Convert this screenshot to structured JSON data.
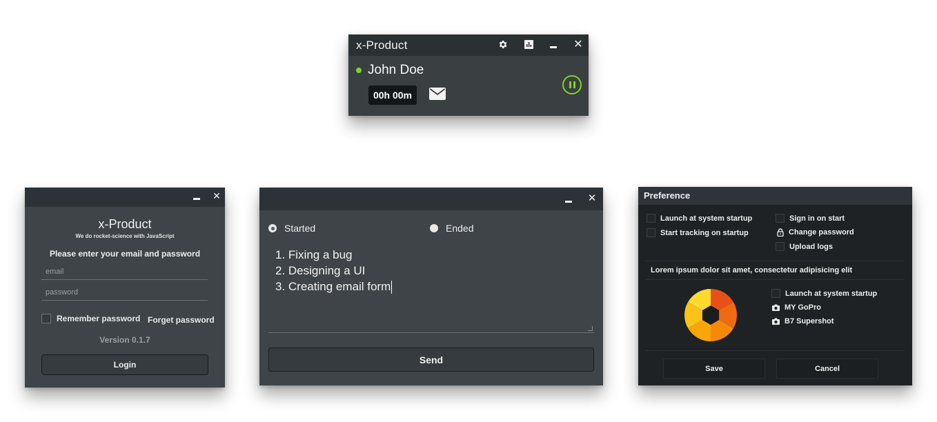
{
  "widget": {
    "title": "x-Product",
    "user_name": "John Doe",
    "timer": "00h 00m",
    "icons": [
      "gear-icon",
      "chart-icon",
      "minimize-icon",
      "close-icon",
      "mail-icon",
      "pause-icon"
    ],
    "status_color": "#7ed321"
  },
  "login": {
    "title": "x-Product",
    "tagline": "We do rocket-science with JavaScript",
    "prompt": "Please enter your email and password",
    "email_placeholder": "email",
    "password_placeholder": "password",
    "remember_label": "Remember password",
    "forget_label": "Forget password",
    "version": "Version 0.1.7",
    "login_label": "Login"
  },
  "tasks": {
    "radio_started": "Started",
    "radio_ended": "Ended",
    "lines": [
      "1. Fixing a bug",
      "2. Designing a UI",
      "3. Creating email form"
    ],
    "send_label": "Send"
  },
  "preference": {
    "title": "Preference",
    "launch_startup": "Launch at system startup",
    "start_tracking": "Start tracking on startup",
    "sign_in": "Sign in on start",
    "change_password": "Change password",
    "upload_logs": "Upload logs",
    "lorem": "Lorem ipsum dolor sit amet, consectetur adipisicing elit",
    "launch_startup_2": "Launch at system startup",
    "device_1": "MY GoPro",
    "device_2": "B7 Supershot",
    "save_label": "Save",
    "cancel_label": "Cancel"
  }
}
